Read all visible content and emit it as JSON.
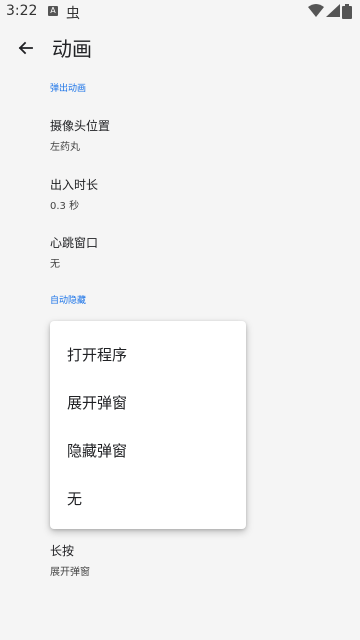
{
  "status_bar": {
    "time": "3:22",
    "icons": [
      "a-notification-icon",
      "bug-icon",
      "wifi-icon",
      "signal-icon",
      "battery-icon"
    ],
    "bug_glyph": "虫"
  },
  "app_bar": {
    "title": "动画",
    "back_icon": "arrow-back-icon"
  },
  "sections": {
    "popup_animation": "弹出动画",
    "auto_hide": "自动隐藏"
  },
  "preferences": {
    "camera_position": {
      "title": "摄像头位置",
      "summary": "左药丸"
    },
    "in_out_duration": {
      "title": "出入时长",
      "summary": "0.3 秒"
    },
    "heartbeat_window": {
      "title": "心跳窗口",
      "summary": "无"
    },
    "long_press": {
      "title": "长按",
      "summary": "展开弹窗"
    }
  },
  "menu": {
    "items": [
      "打开程序",
      "展开弹窗",
      "隐藏弹窗",
      "无"
    ]
  },
  "colors": {
    "accent": "#1a73e8",
    "background": "#f5f5f5",
    "menu_bg": "#ffffff"
  }
}
